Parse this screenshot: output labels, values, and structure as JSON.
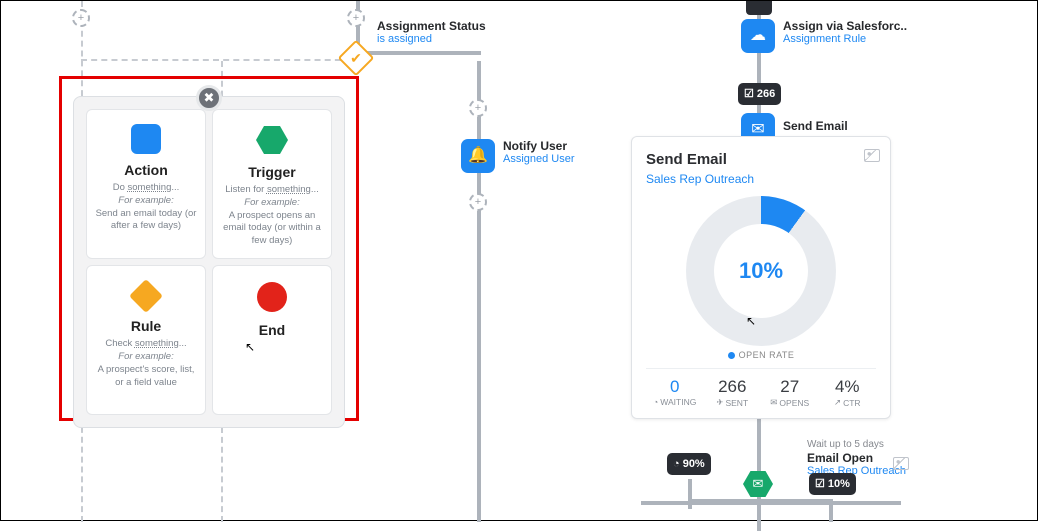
{
  "rule_node": {
    "title": "Assignment Status",
    "subtitle": "is assigned"
  },
  "notify_node": {
    "title": "Notify User",
    "subtitle": "Assigned User"
  },
  "assign_node": {
    "title": "Assign via Salesforc..",
    "subtitle": "Assignment Rule"
  },
  "badge_266": "☑ 266",
  "send_email_node": {
    "title": "Send Email"
  },
  "picker": {
    "action": {
      "title": "Action",
      "desc_lead": "Do ",
      "desc_und": "something",
      "desc_tail": "...",
      "example_label": "For example:",
      "example": "Send an email today (or after a few days)"
    },
    "trigger": {
      "title": "Trigger",
      "desc_lead": "Listen for ",
      "desc_und": "something",
      "desc_tail": "...",
      "example_label": "For example:",
      "example": "A prospect opens an email today (or within a few days)"
    },
    "rule": {
      "title": "Rule",
      "desc_lead": "Check ",
      "desc_und": "something",
      "desc_tail": "...",
      "example_label": "For example:",
      "example": "A prospect's score, list, or a field value"
    },
    "end": {
      "title": "End"
    }
  },
  "email_card": {
    "title": "Send Email",
    "subtitle": "Sales Rep Outreach",
    "legend": "OPEN RATE",
    "center_pct": "10%",
    "stats": [
      {
        "val": "0",
        "lbl": "WAITING",
        "icon": "◔"
      },
      {
        "val": "266",
        "lbl": "SENT",
        "icon": "✈"
      },
      {
        "val": "27",
        "lbl": "OPENS",
        "icon": "✉"
      },
      {
        "val": "4%",
        "lbl": "CTR",
        "icon": "↗"
      }
    ]
  },
  "chart_data": {
    "type": "pie",
    "title": "Open Rate",
    "series": [
      {
        "name": "OPEN RATE",
        "value": 10
      },
      {
        "name": "remainder",
        "value": 90
      }
    ],
    "center_label": "10%"
  },
  "wait_note": "Wait up to 5 days",
  "email_open": {
    "title": "Email Open",
    "subtitle": "Sales Rep Outreach"
  },
  "badge_90": "◔ 90%",
  "badge_10": "☑ 10%"
}
